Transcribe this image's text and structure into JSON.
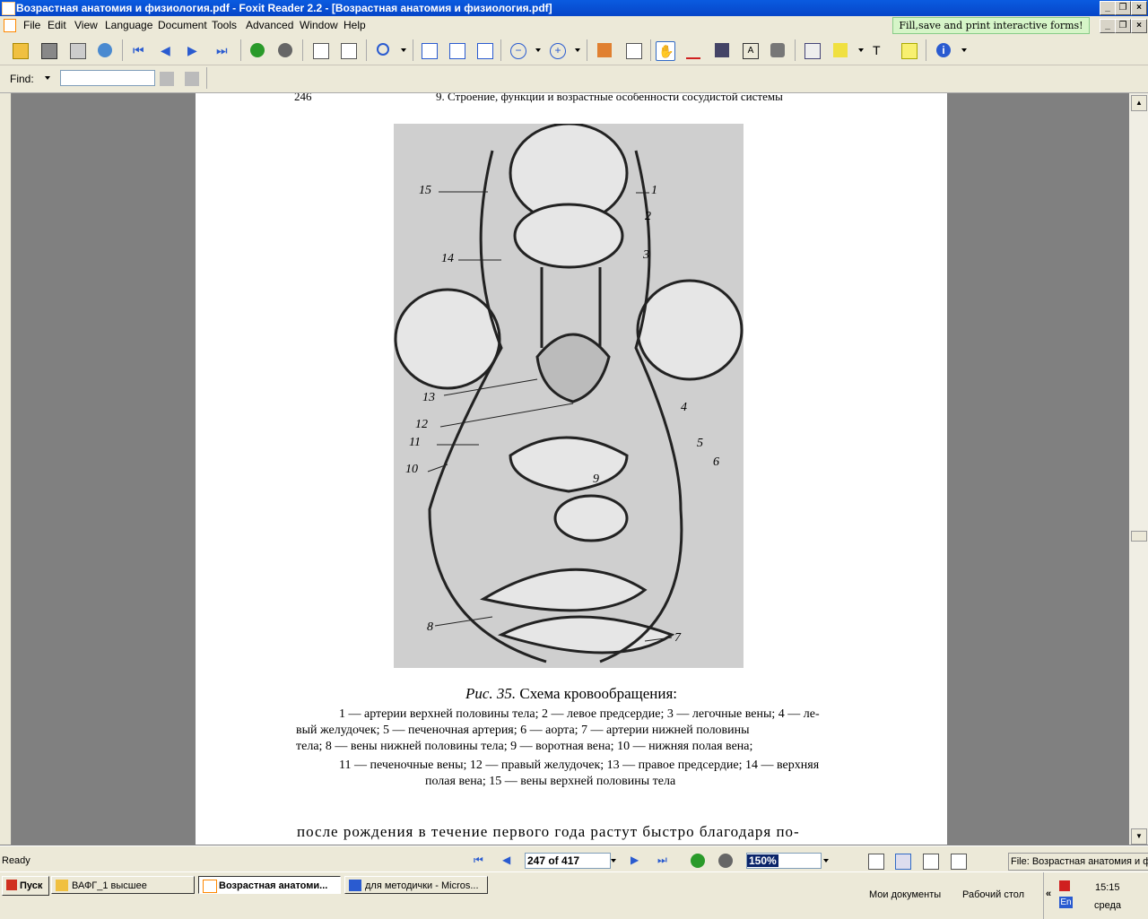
{
  "window": {
    "title": "Возрастная анатомия и физиология.pdf - Foxit Reader 2.2 - [Возрастная анатомия и физиология.pdf]"
  },
  "menu": {
    "items": [
      "File",
      "Edit",
      "View",
      "Language",
      "Document",
      "Tools",
      "Advanced",
      "Window",
      "Help"
    ],
    "forms_button": "Fill,save and print interactive forms!"
  },
  "find": {
    "label": "Find:",
    "value": ""
  },
  "page": {
    "number": "246",
    "running_title": "9. Строение, функции и возрастные особенности сосудистой системы",
    "figure_labels": [
      "15",
      "1",
      "2",
      "14",
      "3",
      "13",
      "4",
      "12",
      "5",
      "11",
      "6",
      "10",
      "9",
      "8",
      "7"
    ],
    "caption_title_italic": "Рис. 35.",
    "caption_title": " Схема кровообращения:",
    "caption_lines": [
      "1 — артерии верхней половины тела; 2 — левое предсердие; 3 — легочные вены; 4 — ле-",
      "вый желудочек;  5 —  печеночная артерия;  6 — аорта;  7 — артерии нижней половины",
      "тела;  8 — вены нижней половины тела;  9 — воротная вена;  10 — нижняя полая вена;",
      "11 — печеночные вены; 12 — правый желудочек; 13 — правое предсердие; 14 — верхняя",
      "полая вена;  15 — вены верхней половины тела"
    ],
    "body_text": "после рождения в течение первого года растут быстро благодаря по-"
  },
  "status": {
    "ready": "Ready",
    "page_indicator": "247 of 417",
    "zoom": "150%",
    "file": "File: Возрастная анатомия и ф"
  },
  "taskbar": {
    "start": "Пуск",
    "tasks": [
      "ВАФГ_1 высшее",
      "Возрастная анатоми...",
      "для методички - Micros..."
    ],
    "quick_links": [
      "Мои документы",
      "Рабочий стол"
    ],
    "clock": "15:15",
    "day": "среда",
    "lang": "En"
  }
}
